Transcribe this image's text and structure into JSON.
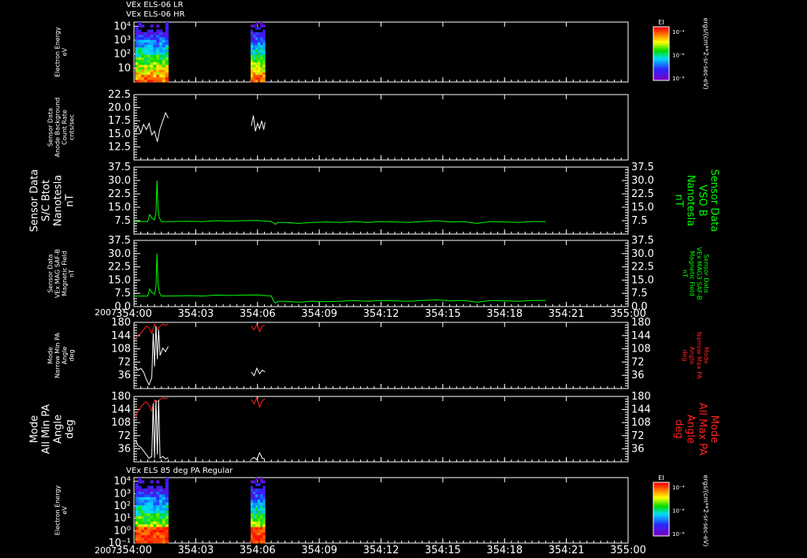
{
  "titles": {
    "top_line1": "VEx ELS-06 LR",
    "top_line2": "VEx ELS-06 HR",
    "bottom": "VEx ELS 85 deg PA Regular"
  },
  "year_label": "2007",
  "colorbar": {
    "label": "EI",
    "units": "ergs/(cm**2-sr-sec-eV)",
    "ticks": [
      "10⁻⁴",
      "10⁻⁶",
      "10⁻⁸"
    ]
  },
  "colors": {
    "background": "#000000",
    "axis": "#ffffff",
    "green_series": "#00ff00",
    "red_series": "#ff2020",
    "white_series": "#ffffff"
  },
  "chart_data": [
    {
      "type": "heatmap",
      "name": "electron-energy-top",
      "ylabel_lines": [
        "Electron Energy",
        "eV"
      ],
      "yscale": "log",
      "yticks": [
        {
          "v": 10,
          "label": "10"
        },
        {
          "v": 100,
          "label": "10²"
        },
        {
          "v": 1000,
          "label": "10³"
        },
        {
          "v": 10000,
          "label": "10⁴"
        }
      ],
      "ylim": [
        1,
        20000
      ],
      "data_intervals": [
        [
          0.17,
          5.0
        ],
        [
          17.0,
          19.1
        ]
      ],
      "xlim": [
        0,
        60
      ]
    },
    {
      "type": "line",
      "name": "anode-background",
      "ylabel_lines": [
        "Sensor Data",
        "Anode Background",
        "Count Rate",
        "cnts/sec"
      ],
      "ylim": [
        10,
        22.5
      ],
      "yticks": [
        12.5,
        15.0,
        17.5,
        20.0,
        22.5
      ],
      "series": [
        {
          "color": "#ffffff",
          "segments": [
            {
              "x": [
                0.2,
                0.6,
                1.0,
                1.4,
                1.8,
                2.2,
                2.6,
                3.0,
                3.4,
                3.8,
                4.2,
                4.6,
                5.0
              ],
              "y": [
                15.5,
                16.5,
                15.2,
                16.8,
                15.8,
                17.0,
                14.8,
                15.5,
                13.5,
                16.0,
                17.5,
                19.0,
                18.0
              ]
            },
            {
              "x": [
                17.1,
                17.4,
                17.7,
                18.0,
                18.3,
                18.6,
                18.9,
                19.1
              ],
              "y": [
                16.5,
                18.5,
                15.5,
                17.0,
                16.0,
                17.5,
                15.8,
                17.2
              ]
            }
          ]
        }
      ]
    },
    {
      "type": "line",
      "name": "sc-btot",
      "ylabel_lines": [
        "Sensor Data",
        "S/C Btot",
        "Nanotesla",
        "nT"
      ],
      "ylabel_right_lines": [
        "Sensor Data",
        "VSO B",
        "Nanotesla",
        "nT"
      ],
      "ylim": [
        0,
        37.5
      ],
      "yticks": [
        7.5,
        15.0,
        22.5,
        30.0,
        37.5
      ],
      "series": [
        {
          "color": "#00ff00",
          "segments": [
            {
              "x": [
                0,
                1,
                2,
                2.3,
                2.6,
                3.0,
                3.2,
                3.35,
                3.5,
                3.7,
                4.0,
                5,
                8,
                10,
                12,
                14,
                16,
                18,
                20.0,
                20.3,
                20.6,
                21,
                22,
                24,
                26,
                28,
                30,
                32,
                34,
                36,
                38,
                40,
                42,
                44,
                46,
                48,
                50,
                52,
                54,
                56,
                58,
                60
              ],
              "y": [
                7,
                7,
                7,
                11,
                9,
                8,
                12,
                30,
                14,
                9,
                7,
                7,
                7.2,
                7,
                7.5,
                7.3,
                7.5,
                7.6,
                7,
                6.3,
                5.5,
                6.5,
                6.5,
                6,
                6.5,
                6.8,
                6.5,
                7,
                6.5,
                7,
                6.8,
                6.5,
                7,
                7.5,
                6.8,
                7,
                6,
                7,
                6.8,
                6.5,
                7,
                7
              ]
            }
          ]
        }
      ]
    },
    {
      "type": "line",
      "name": "mag-saf-b",
      "ylabel_lines": [
        "Sensor Data",
        "VEx MAG SAF-B",
        "Magnetic Field",
        "nT"
      ],
      "ylabel_right_lines": [
        "Sensor Data",
        "VEx MAG3 SAF-B",
        "Magnetic Field",
        "nT"
      ],
      "ylim": [
        0,
        37.5
      ],
      "yticks": [
        0.0,
        7.5,
        15.0,
        22.5,
        30.0,
        37.5
      ],
      "series": [
        {
          "color": "#00ff00",
          "segments": [
            {
              "x": [
                0,
                1,
                2,
                2.3,
                2.6,
                3.0,
                3.2,
                3.35,
                3.5,
                3.7,
                4.0,
                5,
                8,
                10,
                12,
                14,
                16,
                18,
                20.0,
                20.3,
                20.6,
                21,
                22,
                24,
                26,
                28,
                30,
                32,
                34,
                36,
                38,
                40,
                42,
                44,
                46,
                48,
                50,
                52,
                54,
                56,
                58,
                60
              ],
              "y": [
                6,
                6,
                6,
                10,
                8,
                7,
                11,
                30,
                13,
                8,
                6,
                6,
                6.2,
                6,
                6.5,
                6.3,
                6.5,
                6.6,
                6,
                3.5,
                2,
                3,
                3,
                2.5,
                3,
                2.8,
                3,
                3.5,
                3,
                3.5,
                3.2,
                3,
                3.5,
                3.8,
                3.2,
                3.5,
                2.5,
                3.5,
                3.2,
                3,
                3.5,
                3.5
              ]
            }
          ]
        }
      ]
    },
    {
      "type": "line",
      "name": "narrow-pa",
      "ylabel_lines": [
        "Mode",
        "Narrow Min PA",
        "Angle",
        "deg"
      ],
      "ylabel_right_lines": [
        "Mode",
        "Narrow Max PA",
        "Angle",
        "deg"
      ],
      "ylim": [
        0,
        180
      ],
      "yticks": [
        36,
        72,
        108,
        144,
        180
      ],
      "series": [
        {
          "color": "#ff2020",
          "segments": [
            {
              "x": [
                0.2,
                0.6,
                1.0,
                1.4,
                1.8,
                2.2,
                2.6,
                3.0,
                3.4,
                3.8,
                4.2,
                4.6,
                5.0
              ],
              "y": [
                130,
                145,
                150,
                160,
                170,
                165,
                150,
                175,
                160,
                170,
                175,
                172,
                176
              ]
            },
            {
              "x": [
                17.1,
                17.5,
                17.9,
                18.3,
                18.7,
                19.1
              ],
              "y": [
                170,
                160,
                175,
                155,
                170,
                172
              ]
            }
          ]
        },
        {
          "color": "#ffffff",
          "segments": [
            {
              "x": [
                0.2,
                0.6,
                1.0,
                1.4,
                1.8,
                2.2,
                2.6,
                2.8,
                3.0,
                3.2,
                3.4,
                3.6,
                3.8,
                4.2,
                4.6,
                5.0
              ],
              "y": [
                60,
                50,
                55,
                45,
                25,
                10,
                30,
                150,
                60,
                170,
                80,
                160,
                90,
                110,
                100,
                115
              ]
            },
            {
              "x": [
                17.1,
                17.5,
                17.9,
                18.3,
                18.7,
                19.1
              ],
              "y": [
                45,
                35,
                55,
                40,
                50,
                45
              ]
            }
          ]
        }
      ]
    },
    {
      "type": "line",
      "name": "all-pa",
      "ylabel_lines": [
        "Mode",
        "All Min PA",
        "Angle",
        "deg"
      ],
      "ylabel_right_lines": [
        "Mode",
        "All Max PA",
        "Angle",
        "deg"
      ],
      "ylim": [
        0,
        180
      ],
      "yticks": [
        36,
        72,
        108,
        144,
        180
      ],
      "series": [
        {
          "color": "#ff2020",
          "segments": [
            {
              "x": [
                0.2,
                0.6,
                1.0,
                1.4,
                1.8,
                2.2,
                2.6,
                3.0,
                3.4,
                3.8,
                4.2,
                4.6,
                5.0
              ],
              "y": [
                120,
                140,
                150,
                160,
                165,
                155,
                140,
                170,
                165,
                172,
                176,
                174,
                177
              ]
            },
            {
              "x": [
                17.1,
                17.5,
                17.9,
                18.3,
                18.7,
                19.1
              ],
              "y": [
                172,
                160,
                176,
                150,
                168,
                174
              ]
            }
          ]
        },
        {
          "color": "#ffffff",
          "segments": [
            {
              "x": [
                0.2,
                0.6,
                1.0,
                1.4,
                1.8,
                2.2,
                2.6,
                2.8,
                3.0,
                3.2,
                3.4,
                3.6,
                3.8,
                4.2,
                4.6,
                5.0
              ],
              "y": [
                60,
                45,
                40,
                30,
                20,
                10,
                15,
                160,
                10,
                170,
                20,
                170,
                10,
                15,
                8,
                12
              ]
            },
            {
              "x": [
                17.1,
                17.5,
                17.9,
                18.3,
                18.7,
                19.1
              ],
              "y": [
                8,
                12,
                6,
                25,
                10,
                8
              ]
            }
          ]
        }
      ]
    },
    {
      "type": "heatmap",
      "name": "electron-energy-bottom",
      "ylabel_lines": [
        "Electron Energy",
        "eV"
      ],
      "yscale": "log",
      "yticks": [
        {
          "v": 0.1,
          "label": "10⁻¹"
        },
        {
          "v": 1,
          "label": "10⁰"
        },
        {
          "v": 10,
          "label": "10¹"
        },
        {
          "v": 100,
          "label": "10²"
        },
        {
          "v": 1000,
          "label": "10³"
        },
        {
          "v": 10000,
          "label": "10⁴"
        }
      ],
      "ylim": [
        0.1,
        20000
      ],
      "data_intervals": [
        [
          0.17,
          5.0
        ],
        [
          17.0,
          19.1
        ]
      ],
      "xlim": [
        0,
        60
      ]
    }
  ],
  "x_axis": {
    "xlim": [
      0,
      60
    ],
    "ticks": [
      {
        "v": 0,
        "label": "354:00"
      },
      {
        "v": 9,
        "label": "354:03"
      },
      {
        "v": 18,
        "label": "354:06"
      },
      {
        "v": 27,
        "label": "354:09"
      },
      {
        "v": 36,
        "label": "354:12"
      },
      {
        "v": 45,
        "label": "354:15"
      },
      {
        "v": 54,
        "label": "354:18"
      },
      {
        "v": 63,
        "label": "354:21"
      },
      {
        "v": 72,
        "label": "355:00"
      }
    ]
  }
}
